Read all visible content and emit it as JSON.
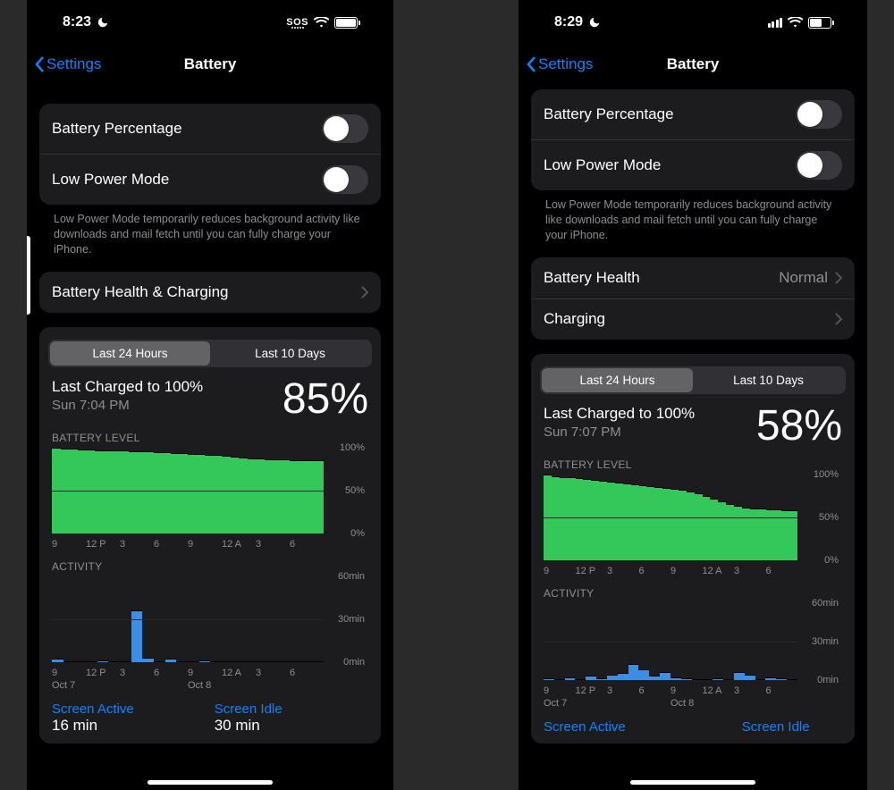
{
  "left": {
    "statusbar": {
      "time": "8:23",
      "net": "SOS",
      "batt_fill_pct": 92
    },
    "nav": {
      "back": "Settings",
      "title": "Battery"
    },
    "toggles": {
      "percentage_label": "Battery Percentage",
      "lowpower_label": "Low Power Mode"
    },
    "footnote": "Low Power Mode temporarily reduces background activity like downloads and mail fetch until you can fully charge your iPhone.",
    "health": {
      "label": "Battery Health & Charging"
    },
    "seg": {
      "a": "Last 24 Hours",
      "b": "Last 10 Days"
    },
    "charge": {
      "title": "Last Charged to 100%",
      "sub": "Sun 7:04 PM",
      "pct": "85%"
    },
    "level_label": "BATTERY LEVEL",
    "activity_label": "ACTIVITY",
    "xticks": [
      "9",
      "12 P",
      "3",
      "6",
      "9",
      "12 A",
      "3",
      "6"
    ],
    "day_a": "Oct 7",
    "day_b": "Oct 8",
    "legend": {
      "active": "Screen Active",
      "active_val": "16 min",
      "idle": "Screen Idle",
      "idle_val": "30 min"
    }
  },
  "right": {
    "statusbar": {
      "time": "8:29",
      "batt_fill_pct": 55
    },
    "nav": {
      "back": "Settings",
      "title": "Battery"
    },
    "toggles": {
      "percentage_label": "Battery Percentage",
      "lowpower_label": "Low Power Mode"
    },
    "footnote": "Low Power Mode temporarily reduces background activity like downloads and mail fetch until you can fully charge your iPhone.",
    "health": {
      "label": "Battery Health",
      "detail": "Normal"
    },
    "charging": {
      "label": "Charging"
    },
    "seg": {
      "a": "Last 24 Hours",
      "b": "Last 10 Days"
    },
    "charge": {
      "title": "Last Charged to 100%",
      "sub": "Sun 7:07 PM",
      "pct": "58%"
    },
    "level_label": "BATTERY LEVEL",
    "activity_label": "ACTIVITY",
    "xticks": [
      "9",
      "12 P",
      "3",
      "6",
      "9",
      "12 A",
      "3",
      "6"
    ],
    "day_a": "Oct 7",
    "day_b": "Oct 8",
    "legend": {
      "active": "Screen Active",
      "idle": "Screen Idle"
    }
  },
  "chart_data": [
    {
      "type": "bar",
      "title": "BATTERY LEVEL (left phone)",
      "ylabel": "Percent",
      "ylim": [
        0,
        100
      ],
      "yticks": [
        "100%",
        "50%",
        "0%"
      ],
      "categories_note": "24 hourly bars from ~9AM Oct 7 to ~8AM Oct 8",
      "values": [
        100,
        99,
        99,
        98,
        98,
        97,
        97,
        96,
        96,
        95,
        95,
        95,
        94,
        94,
        93,
        93,
        92,
        92,
        91,
        91,
        90,
        89,
        88,
        87,
        87,
        86,
        86,
        86,
        85,
        85,
        85,
        85
      ]
    },
    {
      "type": "bar",
      "title": "ACTIVITY (left phone)",
      "ylabel": "Minutes",
      "ylim": [
        0,
        60
      ],
      "yticks": [
        "60min",
        "30min",
        "0min"
      ],
      "values": [
        2,
        0,
        0,
        0,
        1,
        0,
        0,
        36,
        3,
        0,
        2,
        0,
        0,
        1,
        0,
        0,
        0,
        0,
        0,
        0,
        0,
        0,
        0,
        0
      ]
    },
    {
      "type": "bar",
      "title": "BATTERY LEVEL (right phone)",
      "ylabel": "Percent",
      "ylim": [
        0,
        100
      ],
      "yticks": [
        "100%",
        "50%",
        "0%"
      ],
      "values": [
        100,
        98,
        97,
        96,
        95,
        94,
        93,
        92,
        91,
        90,
        89,
        88,
        87,
        86,
        85,
        84,
        83,
        82,
        80,
        78,
        75,
        72,
        68,
        65,
        63,
        61,
        60,
        60,
        59,
        59,
        58,
        58
      ]
    },
    {
      "type": "bar",
      "title": "ACTIVITY (right phone)",
      "ylabel": "Minutes",
      "ylim": [
        0,
        60
      ],
      "yticks": [
        "60min",
        "30min",
        "0min"
      ],
      "values": [
        1,
        0,
        2,
        0,
        3,
        1,
        4,
        5,
        12,
        8,
        3,
        6,
        2,
        1,
        0,
        0,
        1,
        0,
        6,
        4,
        0,
        2,
        1,
        0
      ]
    }
  ],
  "y_level": [
    "100%",
    "50%",
    "0%"
  ],
  "y_act": [
    "60min",
    "30min",
    "0min"
  ]
}
